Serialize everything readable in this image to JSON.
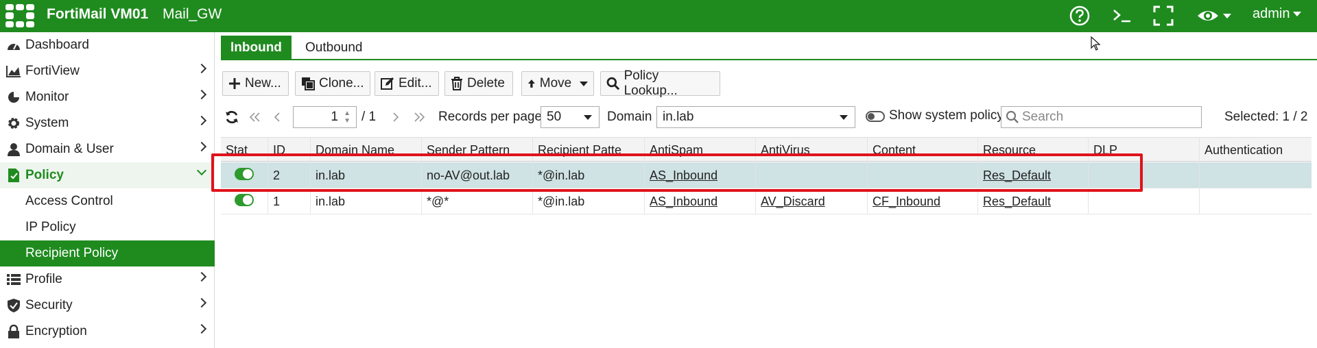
{
  "header": {
    "product": "FortiMail VM01",
    "hostname": "Mail_GW",
    "user": "admin",
    "icons": [
      "help-icon",
      "cli-console-icon",
      "fullscreen-icon",
      "eye-icon"
    ]
  },
  "sidebar": {
    "items": [
      {
        "label": "Dashboard",
        "icon": "dashboard-icon"
      },
      {
        "label": "FortiView",
        "icon": "chart-icon"
      },
      {
        "label": "Monitor",
        "icon": "pie-icon"
      },
      {
        "label": "System",
        "icon": "gear-icon"
      },
      {
        "label": "Domain & User",
        "icon": "user-icon"
      },
      {
        "label": "Policy",
        "icon": "policy-icon"
      },
      {
        "label": "Profile",
        "icon": "list-icon"
      },
      {
        "label": "Security",
        "icon": "shield-icon"
      },
      {
        "label": "Encryption",
        "icon": "lock-icon"
      }
    ],
    "policy_children": [
      "Access Control",
      "IP Policy",
      "Recipient Policy"
    ]
  },
  "tabs": [
    "Inbound",
    "Outbound"
  ],
  "toolbar": {
    "new": "New...",
    "clone": "Clone...",
    "edit": "Edit...",
    "delete": "Delete",
    "move": "Move",
    "lookup": "Policy Lookup..."
  },
  "pager": {
    "page": "1",
    "total": "/ 1",
    "records_label": "Records per page",
    "records_value": "50",
    "domain_label": "Domain",
    "domain_value": "in.lab",
    "show_system": "Show system policy",
    "search_placeholder": "Search",
    "selected": "Selected: 1 / 2"
  },
  "table": {
    "columns": [
      "Stat",
      "ID",
      "Domain Name",
      "Sender Pattern",
      "Recipient Patte",
      "AntiSpam",
      "AntiVirus",
      "Content",
      "Resource",
      "DLP",
      "Authentication"
    ],
    "rows": [
      {
        "id": "2",
        "domain": "in.lab",
        "sender": "no-AV@out.lab",
        "recipient": "*@in.lab",
        "antispam": "AS_Inbound",
        "antivirus": "",
        "content": "",
        "resource": "Res_Default",
        "dlp": "",
        "auth": "",
        "enabled": true,
        "selected": true
      },
      {
        "id": "1",
        "domain": "in.lab",
        "sender": "*@*",
        "recipient": "*@in.lab",
        "antispam": "AS_Inbound",
        "antivirus": "AV_Discard",
        "content": "CF_Inbound",
        "resource": "Res_Default",
        "dlp": "",
        "auth": "",
        "enabled": true,
        "selected": false
      }
    ]
  },
  "colors": {
    "brand_green": "#1f8b1f",
    "selected_row": "#cfe2e4",
    "highlight_red": "#e0121b"
  }
}
